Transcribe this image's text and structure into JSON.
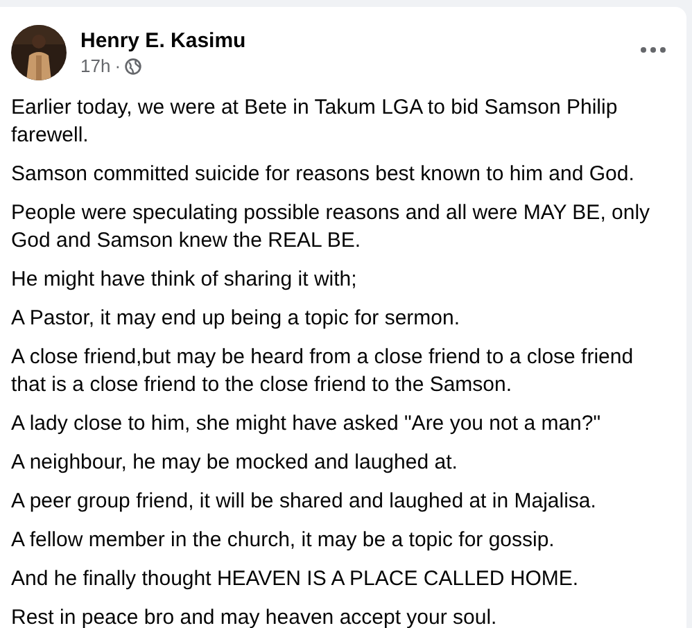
{
  "post": {
    "author": "Henry E. Kasimu",
    "time": "17h",
    "separator": "·",
    "paragraphs": [
      "Earlier today, we were at Bete in Takum LGA to bid Samson Philip farewell.",
      "Samson committed suicide for reasons best known to him and God.",
      "People were speculating possible reasons and all were MAY BE, only God and Samson knew the REAL BE.",
      "He might have think of sharing it with;",
      "A Pastor, it may end up being a topic for sermon.",
      "A close friend,but may be heard from a close friend to a close friend that is a close friend to the close friend to the Samson.",
      "A lady close to him, she might have asked \"Are you not a man?\"",
      "A neighbour, he may be mocked and laughed at.",
      "A peer group friend, it will be shared and laughed at in Majalisa.",
      "A fellow member in the church, it may be a topic for gossip.",
      "And he finally thought HEAVEN IS A PLACE CALLED HOME.",
      "Rest in peace bro and may heaven accept your soul."
    ]
  }
}
